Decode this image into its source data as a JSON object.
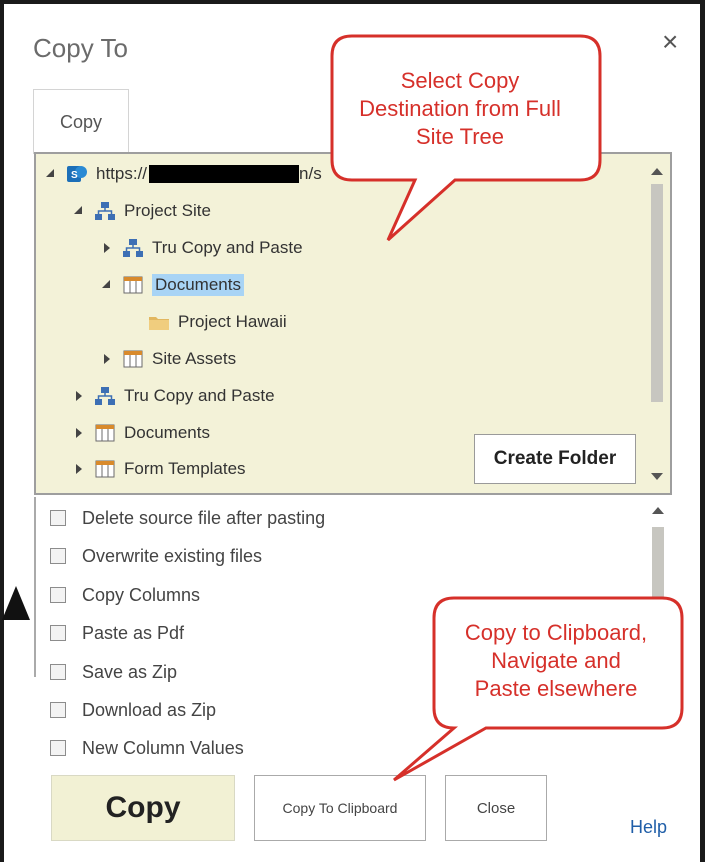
{
  "dialog": {
    "title": "Copy To",
    "close_glyph": "×",
    "tab_label": "Copy"
  },
  "tree": {
    "root_url_prefix": "https://",
    "root_url_suffix": "n/s",
    "items": [
      {
        "label": "Project Site"
      },
      {
        "label": "Tru Copy and Paste"
      },
      {
        "label": "Documents"
      },
      {
        "label": "Project Hawaii"
      },
      {
        "label": "Site Assets"
      },
      {
        "label": "Tru Copy and Paste"
      },
      {
        "label": "Documents"
      },
      {
        "label": "Form Templates"
      }
    ],
    "create_folder_label": "Create Folder"
  },
  "options": [
    {
      "label": "Delete source file after pasting",
      "checked": false
    },
    {
      "label": "Overwrite existing files",
      "checked": false
    },
    {
      "label": "Copy Columns",
      "checked": false
    },
    {
      "label": "Paste as Pdf",
      "checked": false
    },
    {
      "label": "Save as Zip",
      "checked": false
    },
    {
      "label": "Download as Zip",
      "checked": false
    },
    {
      "label": "New Column Values",
      "checked": false
    }
  ],
  "footer": {
    "copy_label": "Copy",
    "clipboard_label": "Copy To Clipboard",
    "close_label": "Close",
    "help_label": "Help"
  },
  "callouts": {
    "top": [
      "Select Copy",
      "Destination from Full",
      "Site Tree"
    ],
    "bottom": [
      "Copy to Clipboard,",
      "Navigate and",
      "Paste elsewhere"
    ]
  },
  "colors": {
    "callout_border": "#d6302a",
    "tree_background": "#f3f2d8",
    "selection": "#a8d4f5",
    "help_link": "#1f5ea8"
  }
}
